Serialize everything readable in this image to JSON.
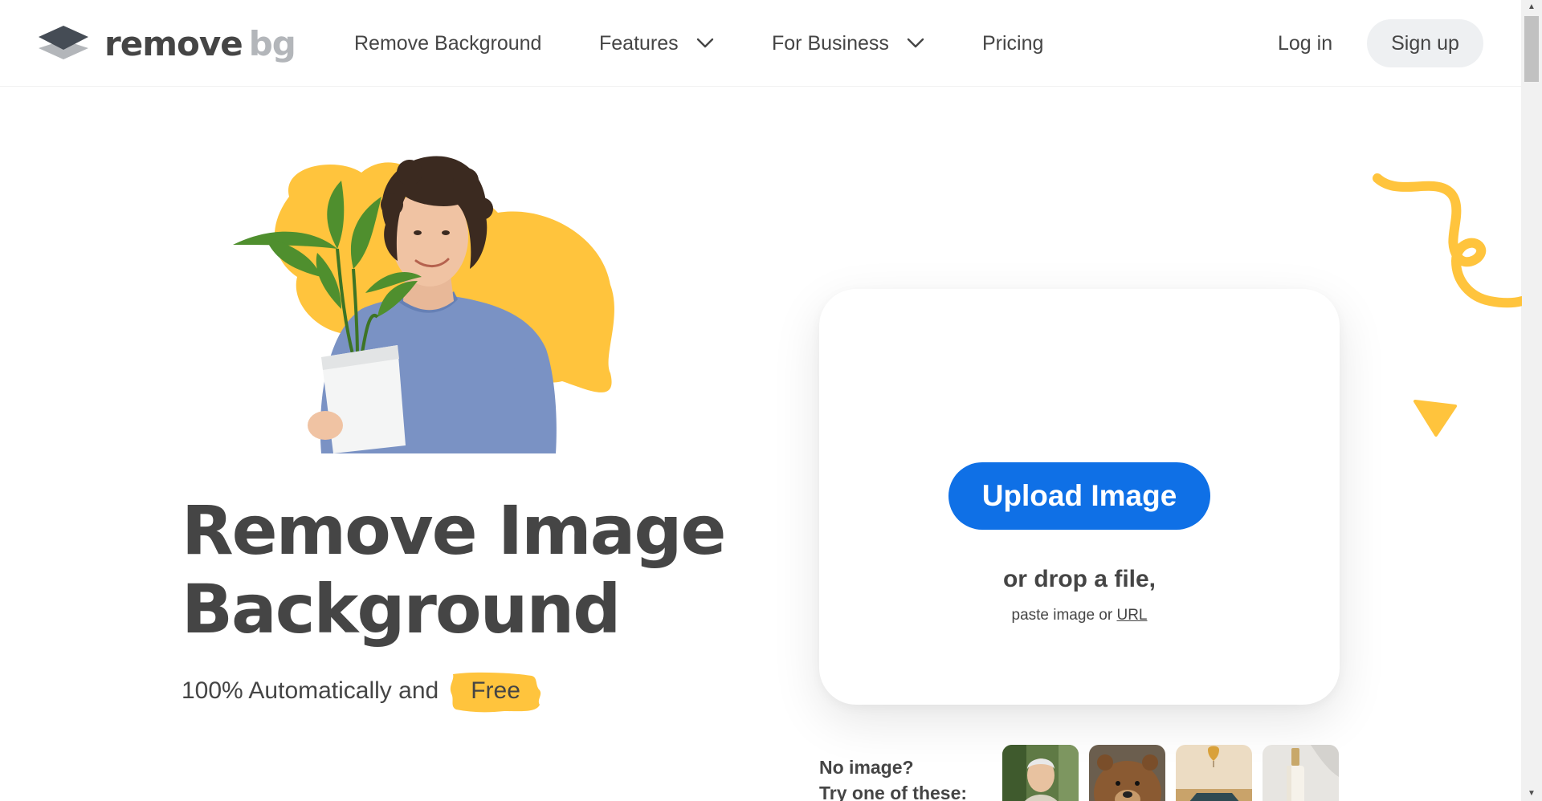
{
  "header": {
    "logo": {
      "word1": "remove",
      "word2": "bg"
    },
    "nav": {
      "remove_background": "Remove Background",
      "features": "Features",
      "for_business": "For Business",
      "pricing": "Pricing"
    },
    "login": "Log in",
    "signup": "Sign up"
  },
  "hero": {
    "title_line1": "Remove Image",
    "title_line2": "Background",
    "subtitle": "100% Automatically and",
    "free": "Free"
  },
  "upload": {
    "button": "Upload Image",
    "drop_text": "or drop a file,",
    "paste_prefix": "paste image or",
    "url_link": "URL"
  },
  "samples": {
    "line1": "No image?",
    "line2": "Try one of these:",
    "items": [
      "person-sample",
      "bear-sample",
      "car-balloon-sample",
      "bottle-sample"
    ]
  },
  "colors": {
    "accent_blue": "#0f70e6",
    "accent_yellow": "#ffc43d",
    "text": "#454545"
  }
}
